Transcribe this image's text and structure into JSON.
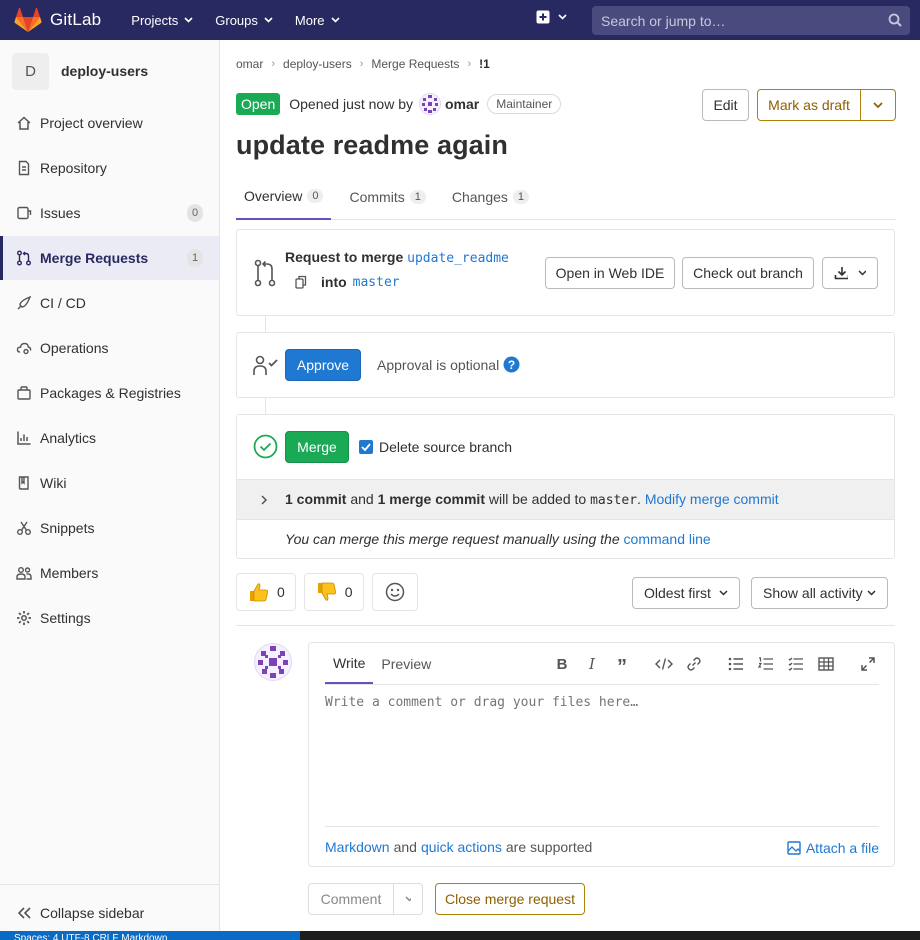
{
  "topbar": {
    "brand": "GitLab",
    "nav": [
      "Projects",
      "Groups",
      "More"
    ],
    "search_placeholder": "Search or jump to…",
    "colors": {
      "bg": "#292961",
      "search_bg": "#4a4a7f"
    }
  },
  "sidebar": {
    "project_initial": "D",
    "project_name": "deploy-users",
    "items": [
      {
        "label": "Project overview",
        "icon": "home-icon"
      },
      {
        "label": "Repository",
        "icon": "doc-icon"
      },
      {
        "label": "Issues",
        "icon": "issues-icon",
        "badge": "0"
      },
      {
        "label": "Merge Requests",
        "icon": "merge-request-icon",
        "badge": "1",
        "active": true
      },
      {
        "label": "CI / CD",
        "icon": "rocket-icon"
      },
      {
        "label": "Operations",
        "icon": "cloud-gear-icon"
      },
      {
        "label": "Packages & Registries",
        "icon": "package-icon"
      },
      {
        "label": "Analytics",
        "icon": "chart-icon"
      },
      {
        "label": "Wiki",
        "icon": "book-icon"
      },
      {
        "label": "Snippets",
        "icon": "scissors-icon"
      },
      {
        "label": "Members",
        "icon": "users-icon"
      },
      {
        "label": "Settings",
        "icon": "gear-icon"
      }
    ],
    "collapse_label": "Collapse sidebar"
  },
  "breadcrumb": [
    "omar",
    "deploy-users",
    "Merge Requests",
    "!1"
  ],
  "mr": {
    "status": "Open",
    "opened_text": "Opened just now by",
    "author": "omar",
    "role": "Maintainer",
    "edit_label": "Edit",
    "draft_label": "Mark as draft",
    "title": "update readme again",
    "tabs": [
      {
        "label": "Overview",
        "count": "0"
      },
      {
        "label": "Commits",
        "count": "1"
      },
      {
        "label": "Changes",
        "count": "1"
      }
    ]
  },
  "widget": {
    "request_text": "Request to merge",
    "source_branch": "update_readme",
    "into_text": "into",
    "target_branch": "master",
    "web_ide_label": "Open in Web IDE",
    "checkout_label": "Check out branch",
    "approve_label": "Approve",
    "approval_text": "Approval is optional",
    "merge_label": "Merge",
    "delete_branch_label": "Delete source branch",
    "delete_branch_checked": true,
    "commit_count": "1 commit",
    "and_text": "and",
    "merge_commit_count": "1 merge commit",
    "added_text": "will be added to",
    "added_branch": "master",
    "modify_label": "Modify merge commit",
    "manual_text": "You can merge this merge request manually using the",
    "command_line_label": "command line"
  },
  "reactions": {
    "thumbs_up": "0",
    "thumbs_down": "0"
  },
  "sort": {
    "order_label": "Oldest first",
    "activity_label": "Show all activity"
  },
  "comment": {
    "write_tab": "Write",
    "preview_tab": "Preview",
    "placeholder": "Write a comment or drag your files here…",
    "markdown_label": "Markdown",
    "and_text": "and",
    "quick_actions_label": "quick actions",
    "supported_text": "are supported",
    "attach_label": "Attach a file",
    "comment_button": "Comment",
    "close_button": "Close merge request"
  },
  "statusbar": {
    "text": "Spaces: 4   UTF-8   CRLF   Markdown"
  }
}
